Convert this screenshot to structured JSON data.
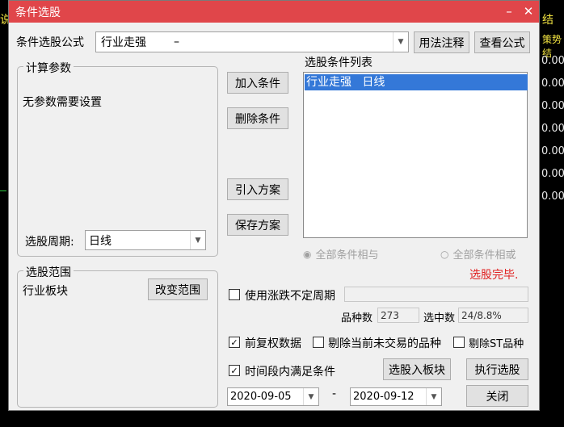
{
  "background_app": {
    "top_fragments": [
      "说",
      "结",
      "策势结"
    ],
    "right_numbers": [
      "0.00",
      "0.00",
      "0.00",
      "0.00",
      "0.00",
      "0.00",
      "0.00"
    ]
  },
  "dialog": {
    "title": "条件选股",
    "formula_label": "条件选股公式",
    "formula_value": "行业走强",
    "formula_dash": "–",
    "usage_button": "用法注释",
    "view_formula_button": "查看公式",
    "calc_params": {
      "label": "计算参数",
      "note": "无参数需要设置",
      "period_label": "选股周期:",
      "period_value": "日线"
    },
    "buttons": {
      "add": "加入条件",
      "delete": "删除条件",
      "import": "引入方案",
      "save": "保存方案"
    },
    "condition_list": {
      "label": "选股条件列表",
      "items": [
        {
          "text": "行业走强   日线",
          "selected": true
        }
      ]
    },
    "logic": {
      "and_label": "全部条件相与",
      "or_label": "全部条件相或",
      "and_selected": true
    },
    "status_text": "选股完毕.",
    "status_color": "#e02020",
    "scope": {
      "label": "选股范围",
      "value": "行业板块",
      "change_button": "改变范围"
    },
    "variable_period": {
      "label": "使用涨跌不定周期",
      "checked": false
    },
    "counts": {
      "total_label": "品种数",
      "total_value": "273",
      "selected_label": "选中数",
      "selected_value": "24/8.8%"
    },
    "options": {
      "adjusted_label": "前复权数据",
      "adjusted_checked": true,
      "exclude_untraded_label": "剔除当前未交易的品种",
      "exclude_untraded_checked": false,
      "exclude_st_label": "剔除ST品种",
      "exclude_st_checked": false,
      "time_range_label": "时间段内满足条件",
      "time_range_checked": true
    },
    "to_block_button": "选股入板块",
    "execute_button": "执行选股",
    "date_from": "2020-09-05",
    "date_sep": "-",
    "date_to": "2020-09-12",
    "close_button": "关闭"
  },
  "colors": {
    "titlebar": "#e0464a",
    "selection": "#3478d8"
  },
  "icons": [
    "minimize-icon",
    "close-icon",
    "dropdown-arrow-icon",
    "checkmark-icon",
    "radio-icon"
  ]
}
